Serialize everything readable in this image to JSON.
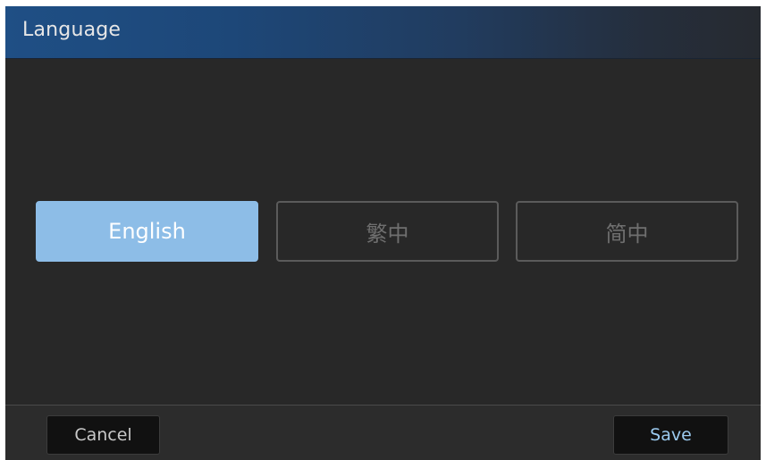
{
  "header": {
    "title": "Language"
  },
  "languages": [
    {
      "label": "English",
      "selected": true
    },
    {
      "label": "繁中",
      "selected": false
    },
    {
      "label": "简中",
      "selected": false
    }
  ],
  "footer": {
    "cancel_label": "Cancel",
    "save_label": "Save"
  },
  "colors": {
    "title_bar": "#1f4f85",
    "background": "#282828",
    "selected_option": "#8dbde7",
    "save_text": "#9ccbf0"
  }
}
